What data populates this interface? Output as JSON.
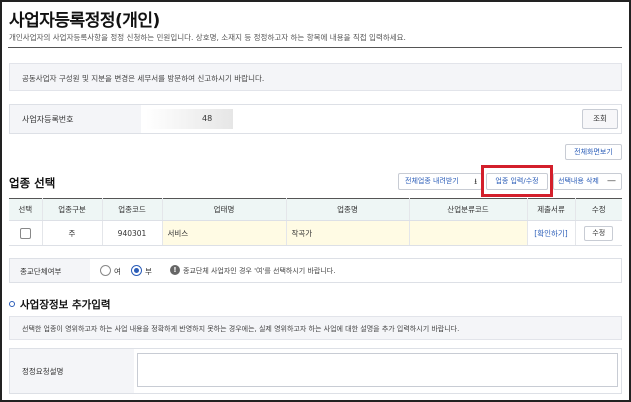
{
  "header": {
    "title": "사업자등록정정(개인)",
    "description": "개인사업자의 사업자등록사항을 정정 신청하는 민원입니다. 상호명, 소재지 등 정정하고자 하는 항목에 내용을 직접 입력하세요."
  },
  "notice": {
    "text": "공동사업자 구성원 및 지분을 변경은 세무서를 방문하여 신고하시기 바랍니다."
  },
  "business_number": {
    "label": "사업자등록번호",
    "value": "48",
    "lookup_label": "조회"
  },
  "fullscreen_label": "전체화면보기",
  "industry_section": {
    "title": "업종 선택",
    "download_label": "전체업종 내려받기",
    "edit_label": "업종 입력/수정",
    "delete_label": "선택내용 삭제",
    "highlight_color": "#d31f2b",
    "columns": [
      "선택",
      "업종구분",
      "업종코드",
      "업태명",
      "업종명",
      "산업분류코드",
      "제출서류",
      "수정"
    ],
    "rows": [
      {
        "type": "주",
        "code": "940301",
        "business_type": "서비스",
        "industry_name": "작곡가",
        "classification_code": "",
        "documents": "[확인하기]",
        "edit": "수정"
      }
    ]
  },
  "joint_business": {
    "label": "종교단체여부",
    "option_yes": "여",
    "option_no": "부",
    "selected": "부",
    "hint": "종교단체 사업자인 경우 '여'를 선택하시기 바랍니다."
  },
  "additional_info": {
    "title": "사업장정보 추가입력",
    "notice": "선택한 업종이 영위하고자 하는 사업 내용을 정확하게 반영하지 못하는 경우에는, 실제 영위하고자 하는 사업에 대한 설명을 추가 입력하시기 바랍니다.",
    "reason_label": "정정요청설명",
    "reason_value": ""
  },
  "colors": {
    "accent": "#2b5db8",
    "table_header_bg": "#eef6f5",
    "highlight_cell_bg": "#fffbe4"
  }
}
